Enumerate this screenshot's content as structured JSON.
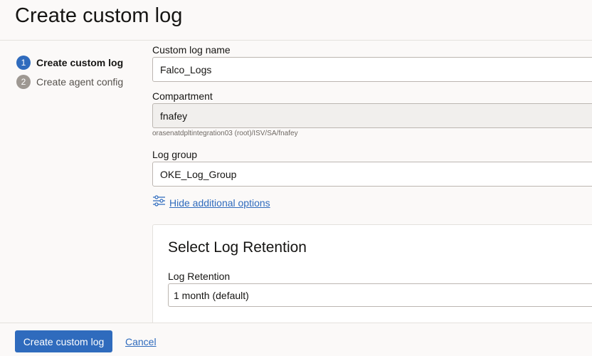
{
  "header": {
    "title": "Create custom log"
  },
  "steps": [
    {
      "number": "1",
      "label": "Create custom log",
      "active": true
    },
    {
      "number": "2",
      "label": "Create agent config",
      "active": false
    }
  ],
  "form": {
    "custom_log_name": {
      "label": "Custom log name",
      "value": "Falco_Logs"
    },
    "compartment": {
      "label": "Compartment",
      "value": "fnafey",
      "help": "orasenatdpltintegration03 (root)/ISV/SA/fnafey"
    },
    "log_group": {
      "label": "Log group",
      "value": "OKE_Log_Group"
    },
    "options_link": {
      "label": "Hide additional options",
      "icon": "sliders-icon"
    }
  },
  "retention": {
    "title": "Select Log Retention",
    "label": "Log Retention",
    "value": "1 month (default)"
  },
  "footer": {
    "primary_label": "Create custom log",
    "cancel_label": "Cancel"
  },
  "colors": {
    "accent": "#2f6bbd",
    "step_inactive": "#9e9892",
    "panel_bg": "#fbf9f8"
  }
}
